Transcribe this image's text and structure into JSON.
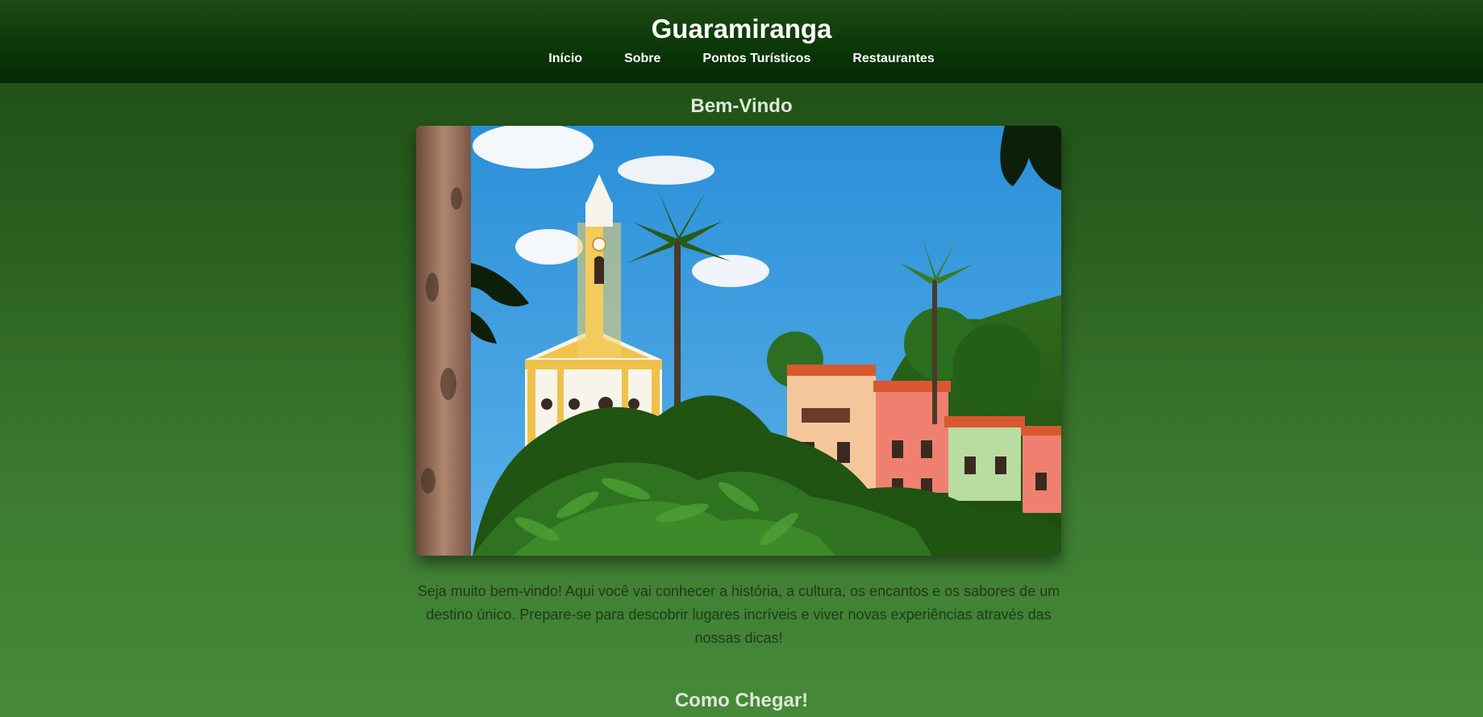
{
  "header": {
    "title": "Guaramiranga",
    "nav": [
      {
        "label": "Início"
      },
      {
        "label": "Sobre"
      },
      {
        "label": "Pontos Turísticos"
      },
      {
        "label": "Restaurantes"
      }
    ]
  },
  "welcome": {
    "title": "Bem-Vindo",
    "text": "Seja muito bem-vindo! Aqui você vai conhecer a história, a cultura, os encantos e os sabores de um destino único. Prepare-se para descobrir lugares incríveis e viver novas experiências através das nossas dicas!"
  },
  "how_to_get": {
    "title": "Como Chegar!"
  }
}
